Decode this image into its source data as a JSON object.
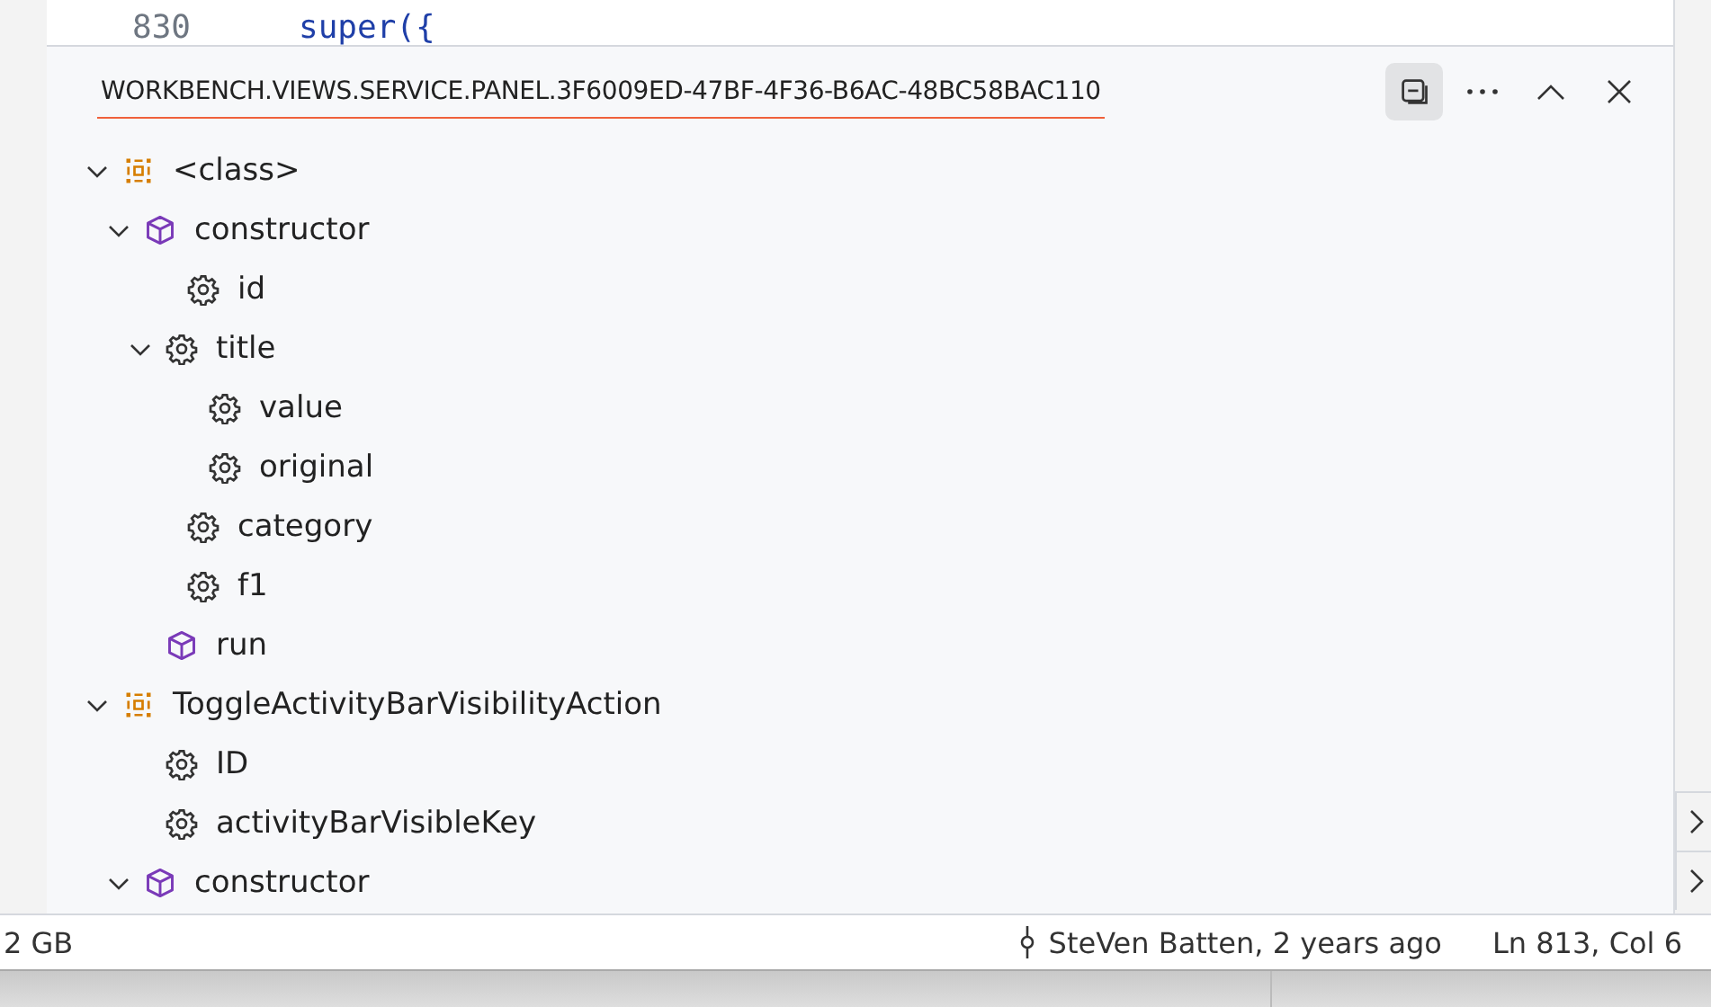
{
  "editor": {
    "line_number": "830",
    "code": "super({"
  },
  "panel": {
    "title": "WORKBENCH.VIEWS.SERVICE.PANEL.3F6009ED-47BF-4F36-B6AC-48BC58BAC110",
    "actions": [
      {
        "kind": "toggle",
        "selected": true
      },
      {
        "kind": "more",
        "selected": false
      },
      {
        "kind": "collapse",
        "selected": false
      },
      {
        "kind": "close",
        "selected": false
      }
    ]
  },
  "outline": [
    {
      "label": "<class>",
      "kind": "class",
      "expanded": true,
      "children": [
        {
          "label": "constructor",
          "kind": "method",
          "expanded": true,
          "children": [
            {
              "label": "id",
              "kind": "field"
            },
            {
              "label": "title",
              "kind": "field",
              "expanded": true,
              "children": [
                {
                  "label": "value",
                  "kind": "field"
                },
                {
                  "label": "original",
                  "kind": "field"
                }
              ]
            },
            {
              "label": "category",
              "kind": "field"
            },
            {
              "label": "f1",
              "kind": "field"
            }
          ]
        },
        {
          "label": "run",
          "kind": "method"
        }
      ]
    },
    {
      "label": "ToggleActivityBarVisibilityAction",
      "kind": "class",
      "expanded": true,
      "children": [
        {
          "label": "ID",
          "kind": "field"
        },
        {
          "label": "activityBarVisibleKey",
          "kind": "field"
        },
        {
          "label": "constructor",
          "kind": "method",
          "expanded": true
        }
      ]
    }
  ],
  "status_bar": {
    "memory": "2 GB",
    "blame": "SteVen Batten, 2 years ago",
    "position": "Ln 813, Col 6"
  }
}
